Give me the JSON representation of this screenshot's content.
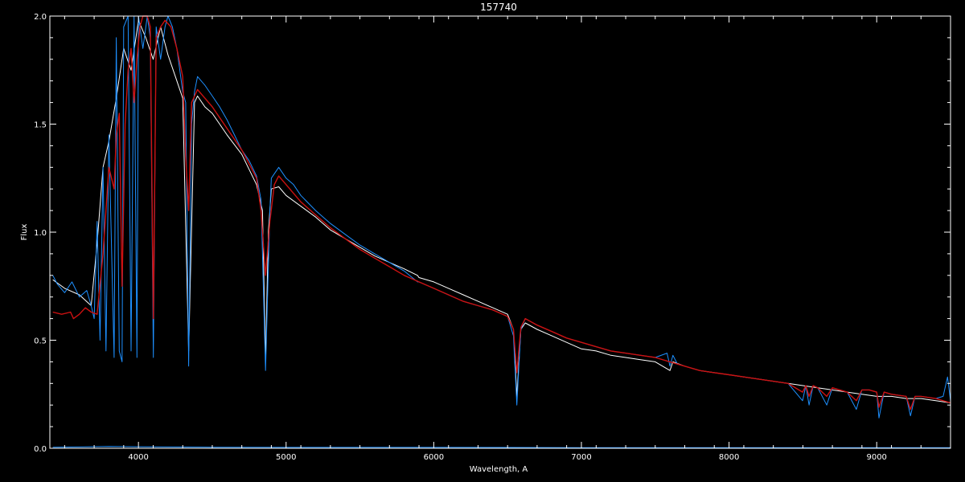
{
  "chart_data": {
    "type": "line",
    "title": "157740",
    "xlabel": "Wavelength, A",
    "ylabel": "Flux",
    "xlim": [
      3400,
      9500
    ],
    "ylim": [
      0.0,
      2.0
    ],
    "xticks": [
      4000,
      5000,
      6000,
      7000,
      8000,
      9000
    ],
    "xtick_labels": [
      "4000",
      "5000",
      "6000",
      "7000",
      "8000",
      "9000"
    ],
    "yticks": [
      0.0,
      0.5,
      1.0,
      1.5,
      2.0
    ],
    "ytick_labels": [
      "0.0",
      "0.5",
      "1.0",
      "1.5",
      "2.0"
    ],
    "background": "#000000",
    "axis_color": "#ffffff",
    "grid": false,
    "series": [
      {
        "color": "#ffffff",
        "x": [
          3420,
          3500,
          3600,
          3680,
          3720,
          3760,
          3800,
          3850,
          3900,
          3950,
          4000,
          4050,
          4100,
          4150,
          4200,
          4250,
          4300,
          4340,
          4380,
          4400,
          4450,
          4500,
          4600,
          4700,
          4800,
          4840,
          4861,
          4880,
          4900,
          4950,
          5000,
          5100,
          5200,
          5300,
          5400,
          5500,
          5600,
          5700,
          5800,
          5890,
          5900,
          6000,
          6100,
          6200,
          6300,
          6400,
          6500,
          6540,
          6563,
          6590,
          6620,
          6700,
          6800,
          6900,
          7000,
          7100,
          7200,
          7300,
          7400,
          7500,
          7600,
          7620,
          7700,
          7800,
          7900,
          8000,
          8100,
          8200,
          8300,
          8400,
          8500,
          8600,
          8700,
          8800,
          8900,
          9000,
          9100,
          9200,
          9300,
          9400,
          9500
        ],
        "y": [
          0.78,
          0.74,
          0.71,
          0.66,
          0.95,
          1.3,
          1.42,
          1.62,
          1.85,
          1.75,
          1.98,
          1.9,
          1.8,
          1.95,
          1.82,
          1.72,
          1.62,
          0.45,
          1.6,
          1.63,
          1.58,
          1.55,
          1.45,
          1.36,
          1.22,
          1.1,
          0.4,
          1.0,
          1.2,
          1.21,
          1.17,
          1.12,
          1.07,
          1.01,
          0.97,
          0.93,
          0.89,
          0.86,
          0.83,
          0.8,
          0.79,
          0.77,
          0.74,
          0.71,
          0.68,
          0.65,
          0.62,
          0.55,
          0.24,
          0.55,
          0.58,
          0.55,
          0.52,
          0.49,
          0.46,
          0.45,
          0.43,
          0.42,
          0.41,
          0.4,
          0.36,
          0.4,
          0.38,
          0.36,
          0.35,
          0.34,
          0.33,
          0.32,
          0.31,
          0.3,
          0.29,
          0.28,
          0.27,
          0.26,
          0.25,
          0.24,
          0.24,
          0.23,
          0.23,
          0.22,
          0.21
        ]
      },
      {
        "color": "#1e90ff",
        "x": [
          3420,
          3450,
          3500,
          3550,
          3600,
          3650,
          3680,
          3700,
          3720,
          3740,
          3760,
          3780,
          3800,
          3835,
          3850,
          3870,
          3889,
          3900,
          3930,
          3950,
          3970,
          3990,
          4000,
          4030,
          4060,
          4080,
          4101,
          4120,
          4150,
          4180,
          4200,
          4230,
          4260,
          4280,
          4300,
          4320,
          4340,
          4360,
          4380,
          4400,
          4450,
          4500,
          4550,
          4600,
          4650,
          4700,
          4750,
          4800,
          4830,
          4861,
          4890,
          4900,
          4950,
          5000,
          5050,
          5100,
          5200,
          5300,
          5400,
          5500,
          5600,
          5700,
          5800,
          5890,
          5900,
          6000,
          6100,
          6200,
          6300,
          6400,
          6500,
          6540,
          6563,
          6590,
          6620,
          6700,
          6800,
          6900,
          7000,
          7100,
          7200,
          7300,
          7400,
          7500,
          7580,
          7600,
          7620,
          7650,
          7700,
          7800,
          7900,
          8000,
          8100,
          8200,
          8300,
          8400,
          8498,
          8520,
          8542,
          8570,
          8600,
          8662,
          8700,
          8750,
          8800,
          8862,
          8900,
          8950,
          9000,
          9015,
          9050,
          9100,
          9200,
          9229,
          9260,
          9300,
          9400,
          9450,
          9480,
          9500
        ],
        "y": [
          0.8,
          0.76,
          0.72,
          0.77,
          0.7,
          0.73,
          0.66,
          0.6,
          1.05,
          0.5,
          1.3,
          0.45,
          1.45,
          0.42,
          1.9,
          0.45,
          0.4,
          1.95,
          2.0,
          0.45,
          2.0,
          0.42,
          2.0,
          1.85,
          2.0,
          1.9,
          0.42,
          1.95,
          1.8,
          1.95,
          2.0,
          1.95,
          1.85,
          1.75,
          1.65,
          1.6,
          0.38,
          1.5,
          1.65,
          1.72,
          1.68,
          1.63,
          1.58,
          1.52,
          1.45,
          1.38,
          1.33,
          1.26,
          1.15,
          0.36,
          1.1,
          1.25,
          1.3,
          1.25,
          1.22,
          1.17,
          1.1,
          1.04,
          0.99,
          0.94,
          0.9,
          0.86,
          0.82,
          0.77,
          0.77,
          0.74,
          0.71,
          0.68,
          0.66,
          0.64,
          0.61,
          0.52,
          0.2,
          0.55,
          0.6,
          0.57,
          0.54,
          0.51,
          0.49,
          0.47,
          0.45,
          0.44,
          0.43,
          0.42,
          0.44,
          0.38,
          0.43,
          0.39,
          0.38,
          0.36,
          0.35,
          0.34,
          0.33,
          0.32,
          0.31,
          0.3,
          0.22,
          0.29,
          0.2,
          0.29,
          0.28,
          0.2,
          0.28,
          0.27,
          0.26,
          0.18,
          0.27,
          0.27,
          0.26,
          0.14,
          0.26,
          0.25,
          0.24,
          0.15,
          0.24,
          0.24,
          0.23,
          0.24,
          0.33,
          0.22
        ]
      },
      {
        "color": "#cc1111",
        "x": [
          3420,
          3480,
          3540,
          3560,
          3600,
          3640,
          3680,
          3720,
          3760,
          3800,
          3835,
          3850,
          3870,
          3889,
          3910,
          3930,
          3950,
          3970,
          3990,
          4010,
          4030,
          4060,
          4080,
          4101,
          4120,
          4150,
          4180,
          4220,
          4260,
          4300,
          4320,
          4340,
          4360,
          4400,
          4450,
          4500,
          4600,
          4700,
          4800,
          4830,
          4861,
          4890,
          4920,
          4950,
          5000,
          5100,
          5200,
          5300,
          5400,
          5500,
          5600,
          5700,
          5800,
          5900,
          6000,
          6100,
          6200,
          6300,
          6400,
          6500,
          6540,
          6563,
          6590,
          6620,
          6700,
          6800,
          6900,
          7000,
          7100,
          7200,
          7300,
          7400,
          7500,
          7600,
          7700,
          7800,
          7900,
          8000,
          8100,
          8200,
          8300,
          8400,
          8498,
          8520,
          8542,
          8570,
          8600,
          8662,
          8700,
          8750,
          8800,
          8862,
          8900,
          8950,
          9000,
          9015,
          9050,
          9100,
          9200,
          9229,
          9260,
          9300,
          9400,
          9500
        ],
        "y": [
          0.63,
          0.62,
          0.63,
          0.6,
          0.62,
          0.65,
          0.63,
          0.62,
          0.9,
          1.3,
          1.2,
          1.45,
          1.55,
          0.75,
          1.5,
          1.75,
          1.85,
          1.6,
          1.8,
          1.95,
          2.0,
          2.0,
          1.95,
          0.6,
          1.9,
          1.95,
          1.98,
          1.95,
          1.85,
          1.72,
          1.35,
          1.1,
          1.6,
          1.66,
          1.62,
          1.58,
          1.48,
          1.38,
          1.25,
          1.1,
          0.8,
          1.05,
          1.22,
          1.26,
          1.22,
          1.14,
          1.08,
          1.02,
          0.97,
          0.92,
          0.88,
          0.84,
          0.8,
          0.77,
          0.74,
          0.71,
          0.68,
          0.66,
          0.64,
          0.61,
          0.55,
          0.35,
          0.56,
          0.6,
          0.57,
          0.54,
          0.51,
          0.49,
          0.47,
          0.45,
          0.44,
          0.43,
          0.42,
          0.4,
          0.38,
          0.36,
          0.35,
          0.34,
          0.33,
          0.32,
          0.31,
          0.3,
          0.26,
          0.29,
          0.24,
          0.29,
          0.28,
          0.24,
          0.28,
          0.27,
          0.26,
          0.22,
          0.27,
          0.27,
          0.26,
          0.19,
          0.26,
          0.25,
          0.24,
          0.18,
          0.24,
          0.24,
          0.23,
          0.21
        ]
      },
      {
        "color": "#1e90ff",
        "x": [
          3420,
          3600,
          3800,
          4000,
          4200,
          4500,
          5000,
          6000,
          7000,
          8000,
          9000,
          9500
        ],
        "y": [
          0.005,
          0.006,
          0.008,
          0.007,
          0.006,
          0.005,
          0.004,
          0.004,
          0.003,
          0.003,
          0.003,
          0.003
        ]
      }
    ]
  }
}
